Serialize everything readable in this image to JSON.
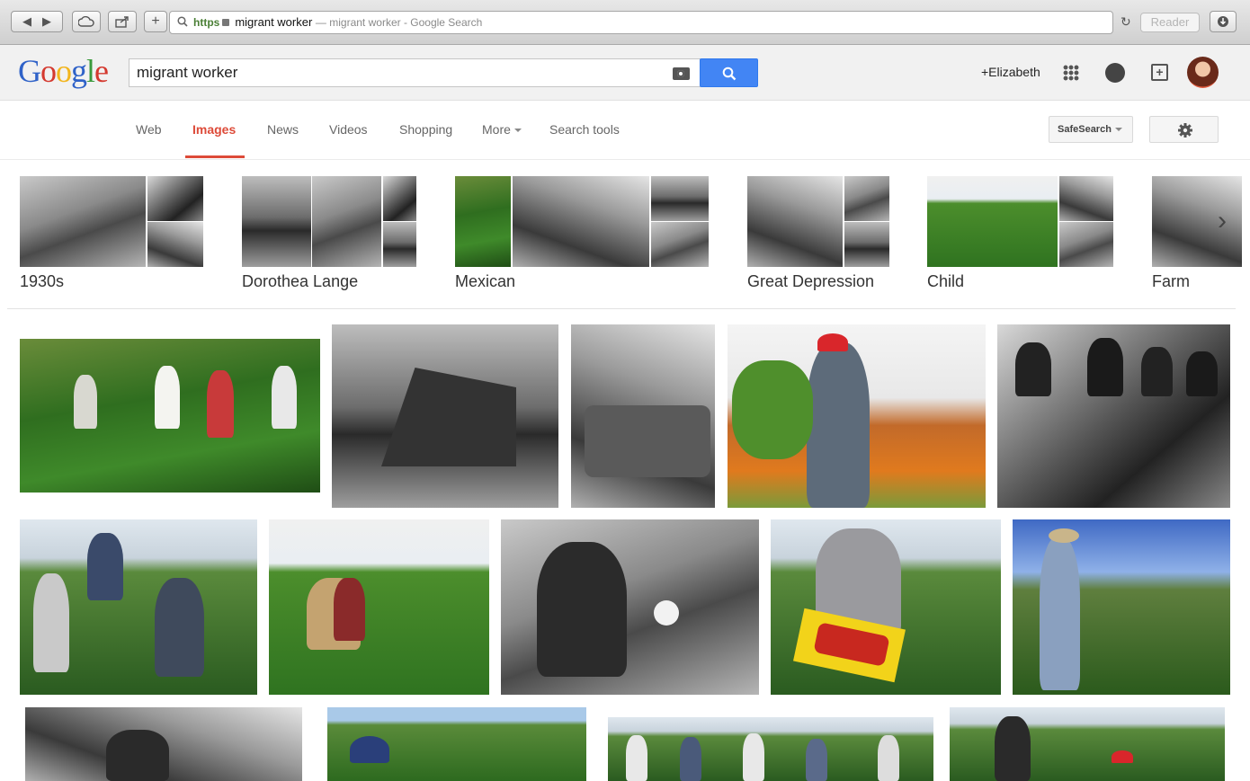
{
  "browser": {
    "url_scheme": "https",
    "url_text": "migrant worker",
    "title_text": "— migrant worker - Google Search",
    "reader_label": "Reader",
    "nav_back": "◀",
    "nav_forward": "▶",
    "new_tab": "+"
  },
  "google": {
    "logo_letters": [
      "G",
      "o",
      "o",
      "g",
      "l",
      "e"
    ],
    "query": "migrant worker",
    "user_link": "+Elizabeth"
  },
  "tabs": [
    {
      "label": "Web",
      "active": false
    },
    {
      "label": "Images",
      "active": true
    },
    {
      "label": "News",
      "active": false
    },
    {
      "label": "Videos",
      "active": false
    },
    {
      "label": "Shopping",
      "active": false
    },
    {
      "label": "More",
      "active": false
    },
    {
      "label": "Search tools",
      "active": false
    }
  ],
  "safesearch_label": "SafeSearch",
  "related": [
    {
      "label": "1930s"
    },
    {
      "label": "Dorothea Lange"
    },
    {
      "label": "Mexican"
    },
    {
      "label": "Great Depression"
    },
    {
      "label": "Child"
    },
    {
      "label": "Farm"
    }
  ],
  "colors": {
    "accent_red": "#dd4b39",
    "search_blue": "#4285f4"
  }
}
